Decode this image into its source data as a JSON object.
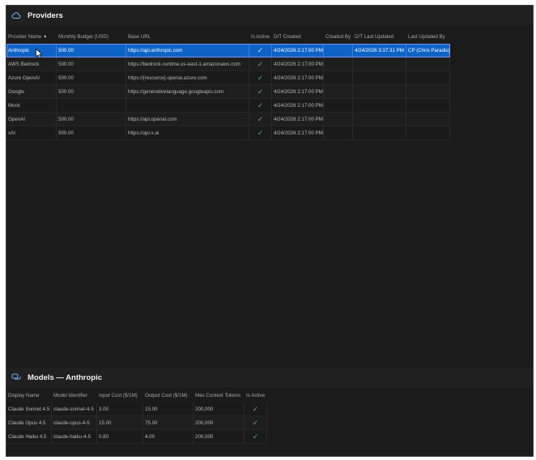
{
  "providers": {
    "title": "Providers",
    "columns": [
      "Provider Name",
      "Monthly Budget (USD)",
      "Base URL",
      "Is Active",
      "D/T Created",
      "Created By",
      "D/T Last Updated",
      "Last Updated By"
    ],
    "rows": [
      {
        "name": "Anthropic",
        "budget": "500.00",
        "url": "https://api.anthropic.com",
        "active": "✓",
        "created": "4/24/2026 2:17:00 PM",
        "created_by": "",
        "updated": "4/24/2026 3:37:31 PM",
        "updated_by": "CP (Chris Paradis)",
        "selected": true
      },
      {
        "name": "AWS Bedrock",
        "budget": "500.00",
        "url": "https://bedrock-runtime.us-east-1.amazonaws.com",
        "active": "✓",
        "created": "4/24/2026 2:17:00 PM",
        "created_by": "",
        "updated": "",
        "updated_by": ""
      },
      {
        "name": "Azure OpenAI",
        "budget": "500.00",
        "url": "https://{resource}.openai.azure.com",
        "active": "✓",
        "created": "4/24/2026 2:17:00 PM",
        "created_by": "",
        "updated": "",
        "updated_by": ""
      },
      {
        "name": "Google",
        "budget": "500.00",
        "url": "https://generativelanguage.googleapis.com",
        "active": "✓",
        "created": "4/24/2026 2:17:00 PM",
        "created_by": "",
        "updated": "",
        "updated_by": ""
      },
      {
        "name": "Mock",
        "budget": "",
        "url": "",
        "active": "✓",
        "created": "4/24/2026 2:17:00 PM",
        "created_by": "",
        "updated": "",
        "updated_by": ""
      },
      {
        "name": "OpenAI",
        "budget": "500.00",
        "url": "https://api.openai.com",
        "active": "✓",
        "created": "4/24/2026 2:17:00 PM",
        "created_by": "",
        "updated": "",
        "updated_by": ""
      },
      {
        "name": "xAI",
        "budget": "500.00",
        "url": "https://api.x.ai",
        "active": "✓",
        "created": "4/24/2026 2:17:00 PM",
        "created_by": "",
        "updated": "",
        "updated_by": ""
      }
    ]
  },
  "models": {
    "title": "Models — Anthropic",
    "columns": [
      "Display Name",
      "Model Identifier",
      "Input Cost ($/1M)",
      "Output Cost ($/1M)",
      "Max Context Tokens",
      "Is Active"
    ],
    "rows": [
      {
        "display": "Claude Sonnet 4.5",
        "ident": "claude-sonnet-4-5",
        "input": "3.00",
        "output": "15.00",
        "ctx": "200,000",
        "active": "✓"
      },
      {
        "display": "Claude Opus 4.5",
        "ident": "claude-opus-4-5",
        "input": "15.00",
        "output": "75.00",
        "ctx": "200,000",
        "active": "✓"
      },
      {
        "display": "Claude Haiku 4.5",
        "ident": "claude-haiku-4-5",
        "input": "0.80",
        "output": "4.00",
        "ctx": "200,000",
        "active": "✓"
      }
    ]
  },
  "icons": {
    "providers": "cloud-icon",
    "models": "chat-bubbles-icon",
    "sort": "sort-ascending-icon"
  },
  "colors": {
    "selection": "#0e63c7",
    "check": "#58b45a",
    "background": "#1b1b1b"
  }
}
